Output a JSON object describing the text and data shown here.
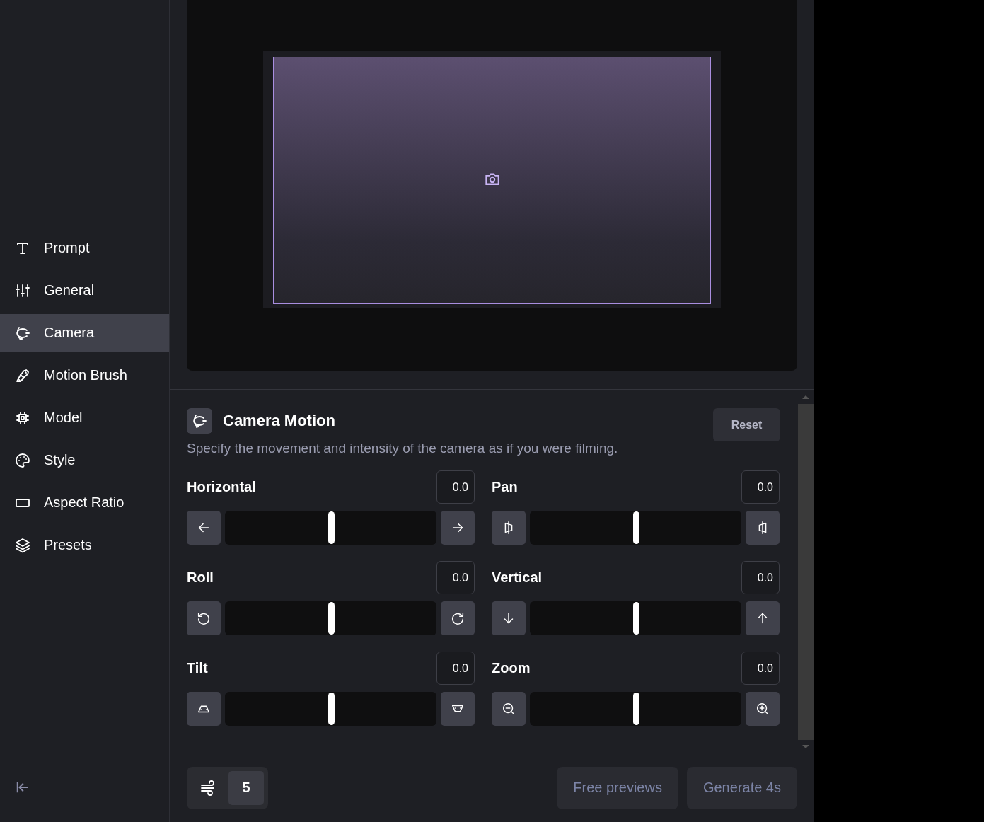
{
  "sidebar": {
    "items": [
      {
        "label": "Prompt",
        "selected": false
      },
      {
        "label": "General",
        "selected": false
      },
      {
        "label": "Camera",
        "selected": true
      },
      {
        "label": "Motion Brush",
        "selected": false
      },
      {
        "label": "Model",
        "selected": false
      },
      {
        "label": "Style",
        "selected": false
      },
      {
        "label": "Aspect Ratio",
        "selected": false
      },
      {
        "label": "Presets",
        "selected": false
      }
    ]
  },
  "camera_motion": {
    "title": "Camera Motion",
    "reset": "Reset",
    "description": "Specify the movement and intensity of the camera as if you were filming.",
    "controls": [
      {
        "label": "Horizontal",
        "value": "0.0",
        "level": 0.5
      },
      {
        "label": "Pan",
        "value": "0.0",
        "level": 0.5
      },
      {
        "label": "Roll",
        "value": "0.0",
        "level": 0.5
      },
      {
        "label": "Vertical",
        "value": "0.0",
        "level": 0.5
      },
      {
        "label": "Tilt",
        "value": "0.0",
        "level": 0.5
      },
      {
        "label": "Zoom",
        "value": "0.0",
        "level": 0.5
      }
    ]
  },
  "footer": {
    "count": "5",
    "buttons": [
      {
        "label": "Free previews",
        "disabled": true
      },
      {
        "label": "Generate 4s",
        "disabled": true
      }
    ]
  }
}
